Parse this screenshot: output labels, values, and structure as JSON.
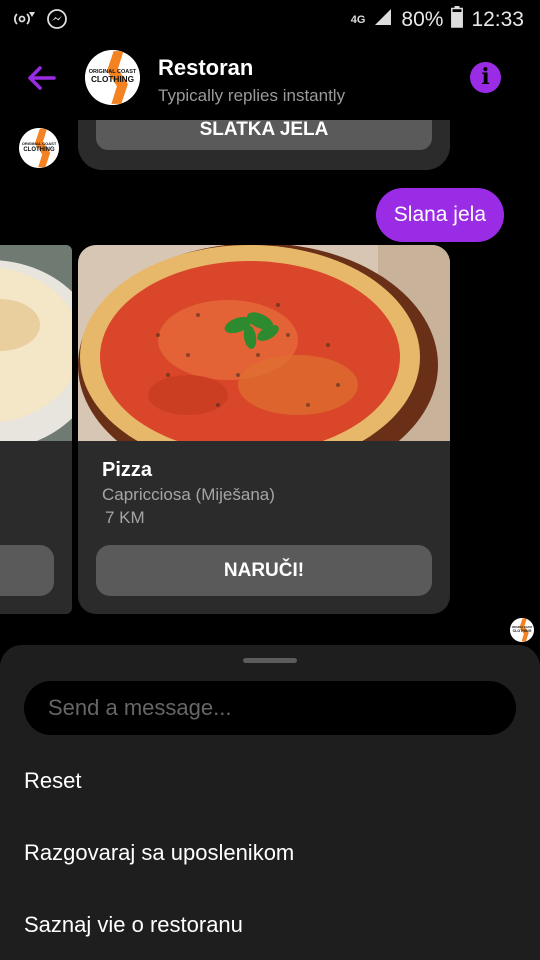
{
  "status_bar": {
    "network": "4G",
    "battery": "80%",
    "time": "12:33",
    "icons": [
      "hotspot-icon",
      "messenger-icon",
      "signal-icon",
      "battery-icon"
    ]
  },
  "header": {
    "title": "Restoran",
    "subtitle": "Typically replies instantly",
    "logo_text_top": "ORIGINAL COAST",
    "logo_text_main": "CLOTHING",
    "info_label": "i"
  },
  "chat": {
    "previous_button": "SLATKA JELA",
    "user_message": "Slana jela",
    "cards": [
      {
        "title": "Pizza",
        "subtitle": "Capricciosa (Miješana)",
        "distance": "7 KM",
        "button": "NARUČI!"
      }
    ]
  },
  "composer": {
    "placeholder": "Send a message..."
  },
  "quick_replies": [
    "Reset",
    "Razgovaraj sa uposlenikom",
    "Saznaj vie o restoranu"
  ],
  "colors": {
    "accent": "#9b2ce6",
    "background": "#000000",
    "card": "#2b2b2b",
    "button": "#5a5a5a",
    "sheet": "#1e1e1e"
  }
}
